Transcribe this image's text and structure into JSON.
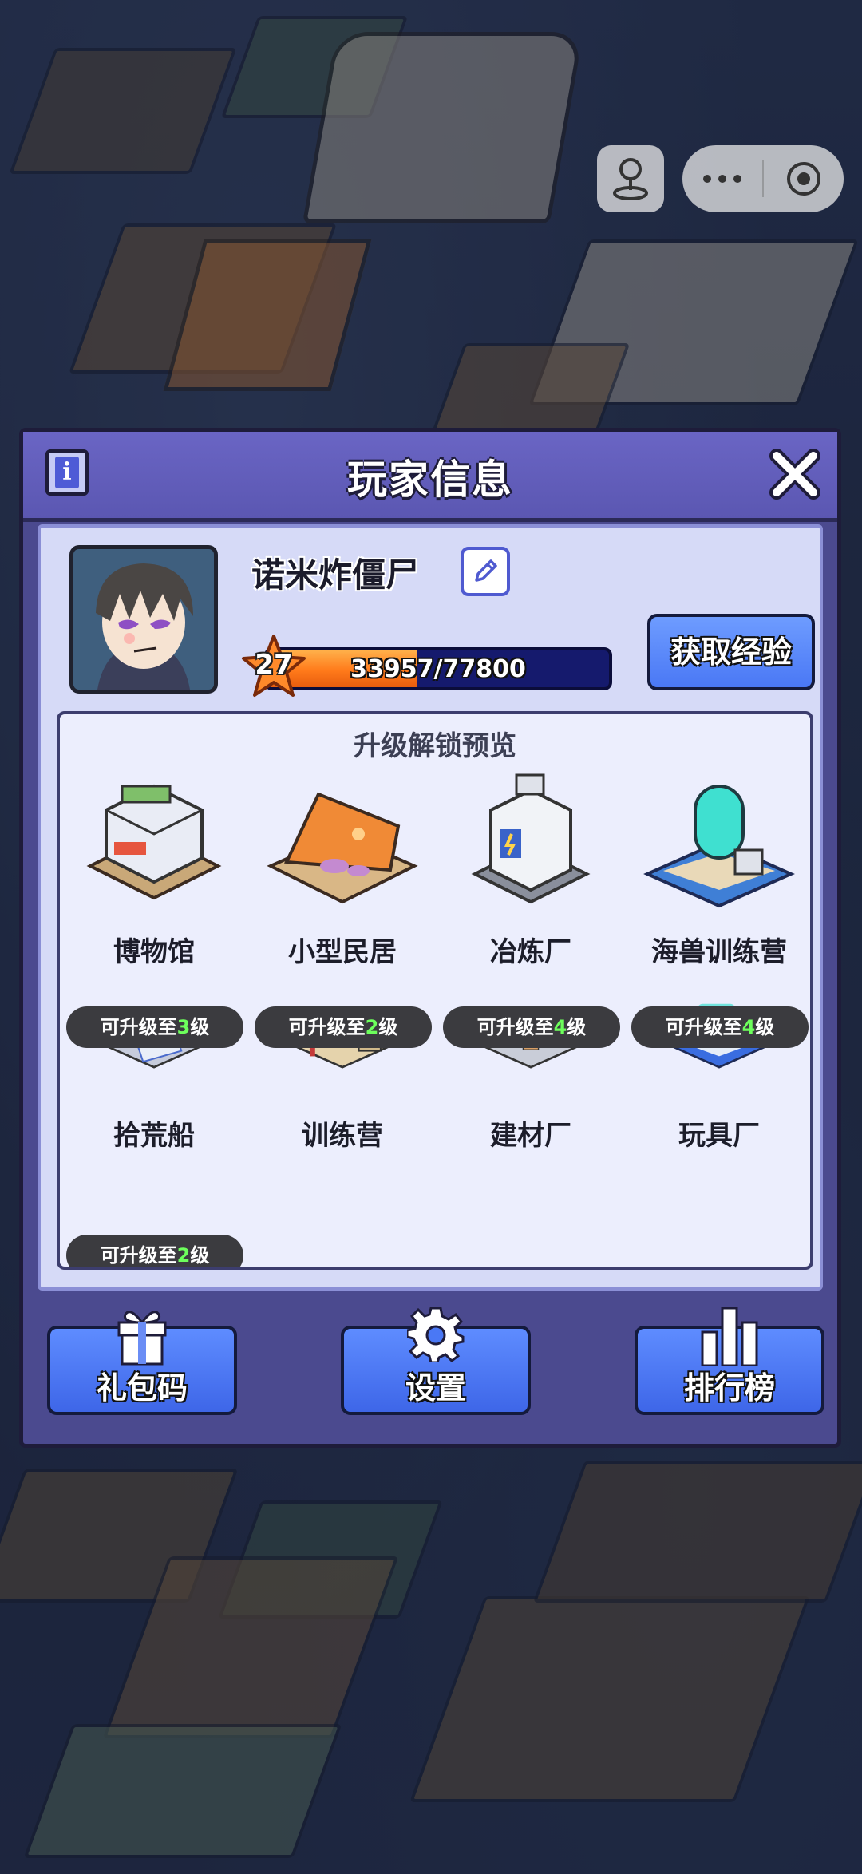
{
  "panel": {
    "title": "玩家信息"
  },
  "player": {
    "name": "诺米炸僵尸",
    "level": "27",
    "xp_text": "33957/77800",
    "xp_progress": 0.436
  },
  "get_exp_button": "获取经验",
  "preview": {
    "title": "升级解锁预览",
    "buildings": [
      {
        "name": "博物馆",
        "badge_prefix": "",
        "badge_level": "",
        "badge_suffix": ""
      },
      {
        "name": "小型民居",
        "badge_prefix": "",
        "badge_level": "",
        "badge_suffix": ""
      },
      {
        "name": "冶炼厂",
        "badge_prefix": "",
        "badge_level": "",
        "badge_suffix": ""
      },
      {
        "name": "海兽训练营",
        "badge_prefix": "",
        "badge_level": "",
        "badge_suffix": ""
      },
      {
        "name": "拾荒船",
        "badge_prefix": "可升级至",
        "badge_level": "3",
        "badge_suffix": "级"
      },
      {
        "name": "训练营",
        "badge_prefix": "可升级至",
        "badge_level": "2",
        "badge_suffix": "级"
      },
      {
        "name": "建材厂",
        "badge_prefix": "可升级至",
        "badge_level": "4",
        "badge_suffix": "级"
      },
      {
        "name": "玩具厂",
        "badge_prefix": "可升级至",
        "badge_level": "4",
        "badge_suffix": "级"
      },
      {
        "name": "",
        "badge_prefix": "可升级至",
        "badge_level": "2",
        "badge_suffix": "级"
      }
    ]
  },
  "actions": {
    "gift_code": "礼包码",
    "settings": "设置",
    "leaderboard": "排行榜"
  },
  "icons": {
    "info": "info-icon",
    "close": "close-icon",
    "edit": "pencil-icon",
    "gift": "gift-icon",
    "gear": "gear-icon",
    "bars": "bar-chart-icon",
    "joystick": "joystick-icon",
    "more": "more-icon",
    "target": "record-icon"
  },
  "colors": {
    "panel": "#4b4a8f",
    "header": "#6a65c4",
    "button_blue": "#4a78f5",
    "xp_fill": "#ff7a1a",
    "badge_level_green": "#6dff5c"
  }
}
